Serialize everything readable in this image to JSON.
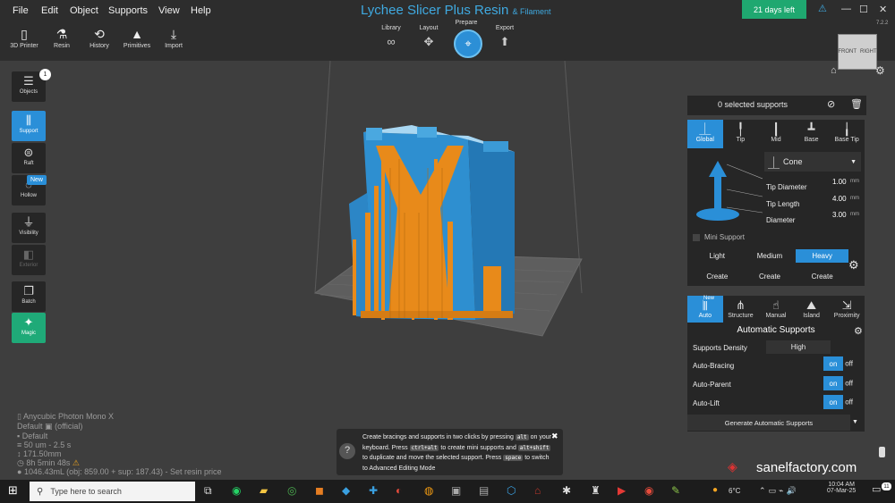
{
  "menu": [
    "File",
    "Edit",
    "Object",
    "Supports",
    "View",
    "Help"
  ],
  "app_title": "Lychee Slicer Plus Resin",
  "app_subtitle": "& Filament",
  "trial": "21 days left",
  "version": "7.2.2",
  "window_controls": [
    "—",
    "☐",
    "✕"
  ],
  "toolbar": [
    {
      "label": "3D Printer",
      "icon": "printer-icon",
      "glyph": "▯"
    },
    {
      "label": "Resin",
      "icon": "resin-bottle-icon",
      "glyph": "⚗"
    },
    {
      "label": "History",
      "icon": "history-icon",
      "glyph": "⟲"
    },
    {
      "label": "Primitives",
      "icon": "primitives-icon",
      "glyph": "▲"
    },
    {
      "label": "Import",
      "icon": "import-icon",
      "glyph": "⤓"
    }
  ],
  "workflow": [
    {
      "label": "Library",
      "icon": "library-icon",
      "glyph": "∞"
    },
    {
      "label": "Layout",
      "icon": "layout-icon",
      "glyph": "✥"
    },
    {
      "label": "Prepare",
      "icon": "prepare-icon",
      "glyph": "⌖"
    },
    {
      "label": "Export",
      "icon": "export-icon",
      "glyph": "⬆"
    }
  ],
  "view_cube": {
    "front": "FRONT",
    "right": "RIGHT"
  },
  "left_tools": [
    {
      "label": "Objects",
      "icon": "objects-list-icon",
      "glyph": "☰",
      "state": "normal"
    },
    {
      "label": "Support",
      "icon": "support-icon",
      "glyph": "⫼",
      "state": "active"
    },
    {
      "label": "Raft",
      "icon": "raft-icon",
      "glyph": "⊜",
      "state": "normal"
    },
    {
      "label": "Hollow",
      "icon": "hollow-icon",
      "glyph": "◌",
      "state": "normal"
    },
    {
      "label": "Visibility",
      "icon": "visibility-icon",
      "glyph": "⏚",
      "state": "normal"
    },
    {
      "label": "Exterior",
      "icon": "exterior-icon",
      "glyph": "◧",
      "state": "disabled"
    },
    {
      "label": "Batch",
      "icon": "batch-icon",
      "glyph": "❐",
      "state": "normal"
    },
    {
      "label": "Magic",
      "icon": "magic-wand-icon",
      "glyph": "✦",
      "state": "magic"
    }
  ],
  "objects_count": "1",
  "hollow_badge": "New",
  "supports_panel": {
    "selected": "0 selected supports",
    "tabs": [
      {
        "label": "Global",
        "glyph": "⏊",
        "icon": "global-support-icon"
      },
      {
        "label": "Tip",
        "glyph": "╿",
        "icon": "tip-icon"
      },
      {
        "label": "Mid",
        "glyph": "┃",
        "icon": "mid-icon"
      },
      {
        "label": "Base",
        "glyph": "┻",
        "icon": "base-icon"
      },
      {
        "label": "Base Tip",
        "glyph": "╽",
        "icon": "base-tip-icon"
      }
    ],
    "tip_shape": "Cone",
    "params": [
      {
        "label": "Tip Diameter",
        "value": "1.00",
        "unit": "mm"
      },
      {
        "label": "Tip Length",
        "value": "4.00",
        "unit": "mm"
      },
      {
        "label": "Diameter",
        "value": "3.00",
        "unit": "mm"
      }
    ],
    "mini_support": "Mini Support",
    "presets": [
      "Light",
      "Medium",
      "Heavy"
    ],
    "create": "Create",
    "mode_tabs": [
      {
        "label": "Auto",
        "glyph": "⫼",
        "icon": "auto-icon",
        "badge": "New"
      },
      {
        "label": "Structure",
        "glyph": "⋔",
        "icon": "structure-icon"
      },
      {
        "label": "Manual",
        "glyph": "☝",
        "icon": "manual-icon"
      },
      {
        "label": "Island",
        "glyph": "⛰",
        "icon": "island-icon"
      },
      {
        "label": "Proximity",
        "glyph": "⇲",
        "icon": "proximity-icon"
      }
    ],
    "auto_title": "Automatic Supports",
    "density_label": "Supports Density",
    "density_value": "High",
    "toggles": [
      {
        "label": "Auto-Bracing",
        "on": "on",
        "off": "off"
      },
      {
        "label": "Auto-Parent",
        "on": "on",
        "off": "off"
      },
      {
        "label": "Auto-Lift",
        "on": "on",
        "off": "off"
      }
    ],
    "generate": "Generate Automatic Supports"
  },
  "status": {
    "printer": "Anycubic Photon Mono X",
    "profile": "Default",
    "profile_note": "(official)",
    "resin": "Default",
    "layer": "50 um - 2.5 s",
    "height": "171.50mm",
    "time": "8h 5min 48s",
    "volume": "1046.43mL (obj: 859.00 + sup: 187.43) - Set resin price"
  },
  "tip": {
    "t1": "Create bracings and supports in two clicks by pressing",
    "k1": "alt",
    "t2": "on your keyboard. Press",
    "k2": "ctrl+alt",
    "t3": "to create mini supports and",
    "k3": "alt+shift",
    "t4": "to duplicate and move the selected support. Press",
    "k4": "space",
    "t5": "to switch to Advanced Editing Mode"
  },
  "watermark": "sanelfactory.com",
  "taskbar": {
    "search_placeholder": "Type here to search",
    "weather": "6°C",
    "time": "10:04 AM",
    "date": "07-Mar-25",
    "notifications": "11"
  },
  "colors": {
    "accent": "#2a8fd8",
    "model": "#2e8fd0",
    "support": "#e88a1a",
    "trial": "#1fa870"
  }
}
